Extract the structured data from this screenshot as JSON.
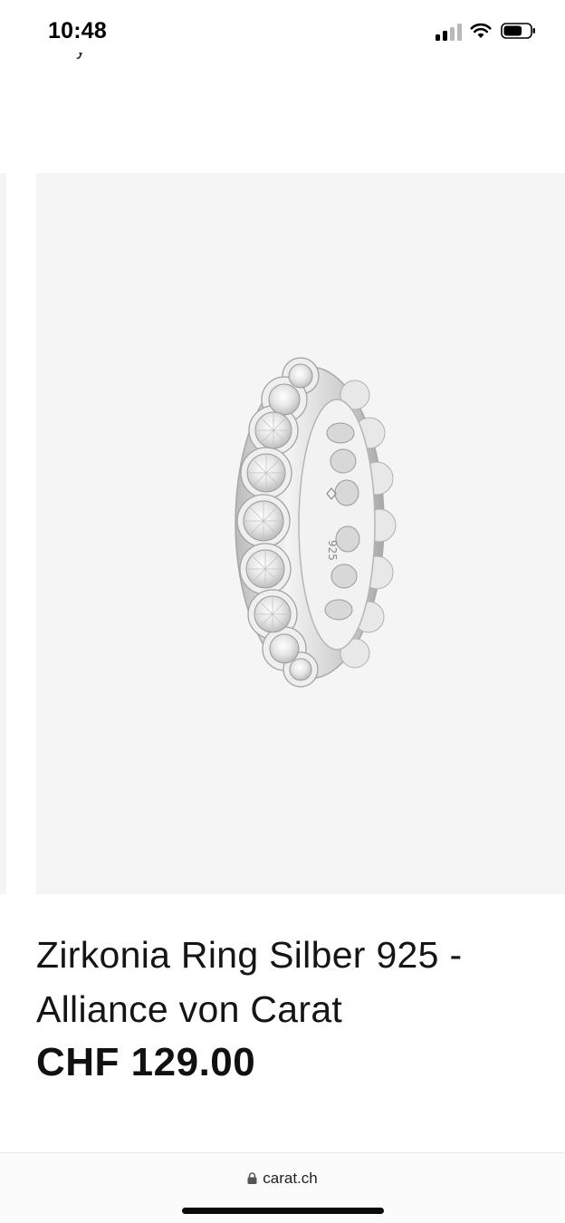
{
  "status_bar": {
    "time": "10:48",
    "signal_icon": "cellular-signal-icon",
    "wifi_icon": "wifi-icon",
    "battery_icon": "battery-icon",
    "battery_level": 0.7
  },
  "product": {
    "image_alt": "ring-photo",
    "engraving": "925",
    "wishlist_icon": "heart-outline-icon",
    "title": "Zirkonia Ring Silber 925 - Alliance von Carat",
    "price": "CHF 129.00",
    "background": "#f5f5f5"
  },
  "browser": {
    "lock_icon": "lock-icon",
    "url": "carat.ch"
  }
}
